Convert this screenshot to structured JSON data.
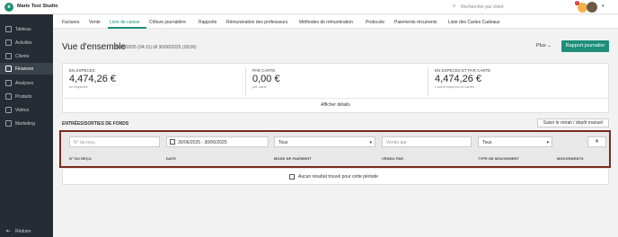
{
  "topbar": {
    "studio_name": "Marie Test Studio",
    "search_placeholder": "Rechercher par client",
    "notification_count": "1"
  },
  "sidebar": {
    "items": [
      {
        "label": "Tableau",
        "icon": "dashboard-icon"
      },
      {
        "label": "Activités",
        "icon": "activities-icon"
      },
      {
        "label": "Clients",
        "icon": "clients-icon"
      },
      {
        "label": "Finances",
        "icon": "finances-icon",
        "active": true
      },
      {
        "label": "Analyses",
        "icon": "analytics-icon"
      },
      {
        "label": "Produits",
        "icon": "products-icon"
      },
      {
        "label": "Vidéos",
        "icon": "video-icon"
      },
      {
        "label": "Marketing",
        "icon": "marketing-icon"
      }
    ],
    "reduce_label": "Réduire"
  },
  "tabs": [
    {
      "label": "Factures"
    },
    {
      "label": "Vente"
    },
    {
      "label": "Livre de caisse",
      "active": true
    },
    {
      "label": "Clôture journalière"
    },
    {
      "label": "Rapports"
    },
    {
      "label": "Rémunération des professeurs"
    },
    {
      "label": "Méthodes de rémunération"
    },
    {
      "label": "Protocole"
    },
    {
      "label": "Paiements récurrents"
    },
    {
      "label": "Liste des Cartes Cadeaux"
    }
  ],
  "header": {
    "title": "Vue d'ensemble",
    "date_range": "30/06/2025 (04:11) till 30/06/2025 (18:06)",
    "plus_label": "Plus",
    "report_button": "Rapport journalier"
  },
  "summary": {
    "cash": {
      "label": "EN ESPÈCES",
      "value": "4,474,26 €",
      "sub": "en espèces"
    },
    "card": {
      "label": "PAR CARTE",
      "value": "0,00 €",
      "sub": "par carte"
    },
    "total": {
      "label": "EN ESPÈCES ET PAR CARTE",
      "value": "4,474,26 €",
      "sub": "Cumul espèces et cartes"
    },
    "details_label": "Afficher détails"
  },
  "flows": {
    "title": "ENTRÉES/SORTIES DE FONDS",
    "manual_button": "Saisir le retrait / dépôt manuel",
    "filters": {
      "receipt_placeholder": "N° du reçu",
      "date_range": "30/06/2025 - 30/06/2025",
      "payment_mode": "Tous",
      "sold_by_placeholder": "Vendu par",
      "movement_type": "Tous",
      "clear_icon": "close-icon"
    },
    "columns": [
      "N° DU REÇU",
      "DATE",
      "MODE DE PAIEMENT",
      "VENDU PAR",
      "TYPE DE MOUVEMENT",
      "MOUVEMENTS"
    ],
    "empty_message": "Aucun résultat trouvé pour cette période"
  },
  "colors": {
    "accent": "#1e8e79",
    "sidebar": "#262c33",
    "highlight_border": "#7a2a1e"
  }
}
